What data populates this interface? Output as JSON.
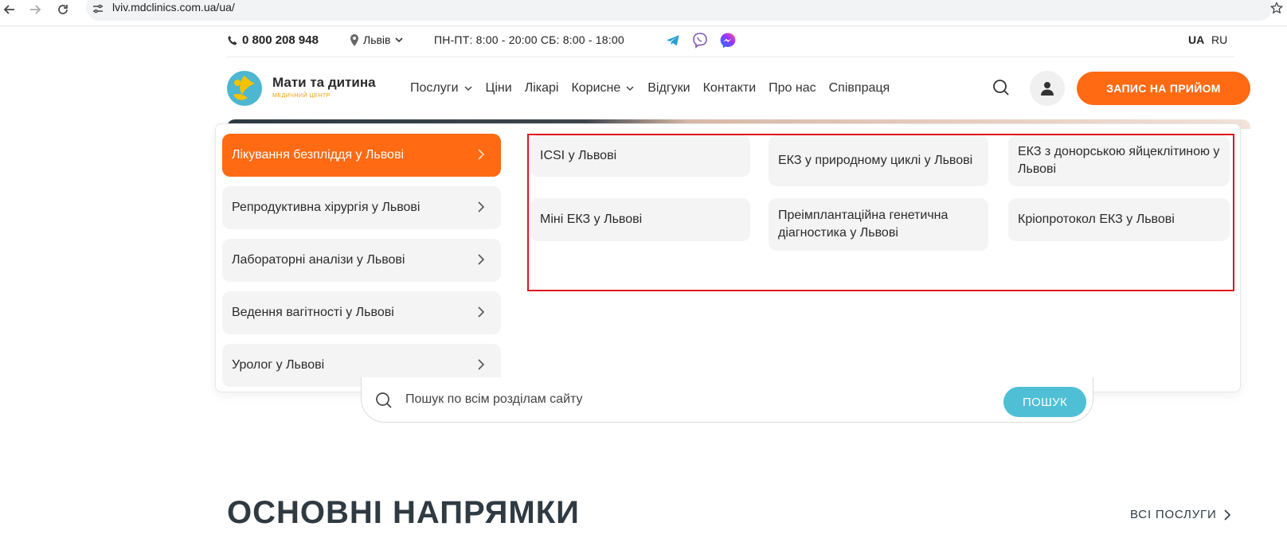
{
  "browser": {
    "url": "lviv.mdclinics.com.ua/ua/"
  },
  "topbar": {
    "phone": "0 800 208 948",
    "city": "Львів",
    "hours": "ПН-ПТ: 8:00 - 20:00  СБ: 8:00 - 18:00",
    "messengers": [
      "telegram-icon",
      "viber-icon",
      "messenger-icon"
    ],
    "lang_ua": "UA",
    "lang_ru": "RU"
  },
  "header": {
    "logo_name": "Мати та дитина",
    "logo_sub": "медичний центр",
    "menu": [
      {
        "label": "Послуги",
        "dropdown": true
      },
      {
        "label": "Ціни",
        "dropdown": false
      },
      {
        "label": "Лікарі",
        "dropdown": false
      },
      {
        "label": "Корисне",
        "dropdown": true
      },
      {
        "label": "Відгуки",
        "dropdown": false
      },
      {
        "label": "Контакти",
        "dropdown": false
      },
      {
        "label": "Про нас",
        "dropdown": false
      },
      {
        "label": "Співпраця",
        "dropdown": false
      }
    ],
    "cta": "ЗАПИС НА ПРИЙОМ"
  },
  "dropdown": {
    "categories": [
      {
        "label": "Лікування безпліддя у Львові",
        "active": true
      },
      {
        "label": "Репродуктивна хірургія у Львові",
        "active": false
      },
      {
        "label": "Лабораторні аналізи у Львові",
        "active": false
      },
      {
        "label": "Ведення вагітності у Львові",
        "active": false
      },
      {
        "label": "Уролог у Львові",
        "active": false
      }
    ],
    "subitems": [
      {
        "label": "ICSI у Львові"
      },
      {
        "label": "ЕКЗ у природному циклі у Львові"
      },
      {
        "label": "ЕКЗ з донорською яйцеклітиною у Львові"
      },
      {
        "label": "Міні ЕКЗ у Львові"
      },
      {
        "label": "Преімплантаційна генетична діагностика у Львові"
      },
      {
        "label": "Кріопротокол ЕКЗ у Львові"
      }
    ]
  },
  "search": {
    "placeholder": "Пошук по всім розділам сайту",
    "button": "ПОШУК"
  },
  "section": {
    "title": "ОСНОВНІ НАПРЯМКИ",
    "all_link": "ВСІ ПОСЛУГИ"
  },
  "colors": {
    "accent": "#ff6a13",
    "search_button": "#4fbfd6",
    "highlight_frame": "#e0141f"
  }
}
